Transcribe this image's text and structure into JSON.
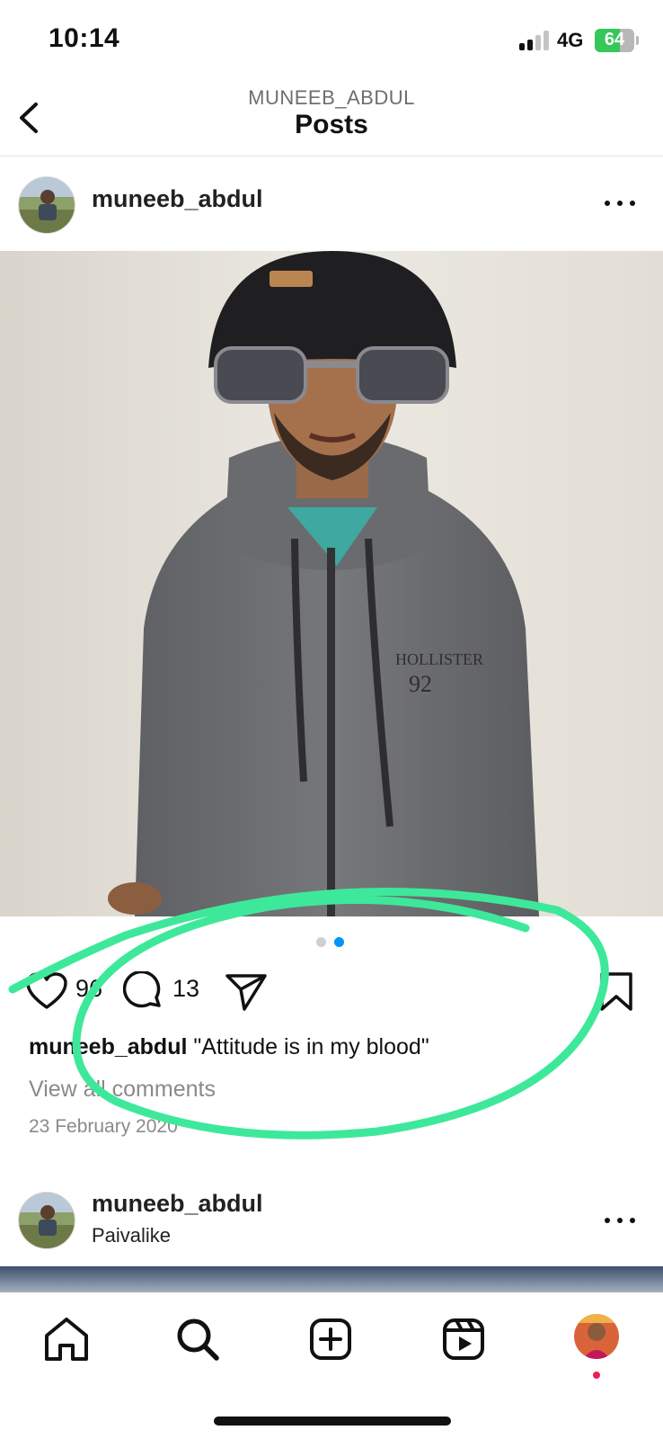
{
  "status_bar": {
    "time": "10:14",
    "network": "4G",
    "battery_level": "64",
    "battery_percent": 64,
    "signal_bars_active": 2,
    "signal_bars_total": 4
  },
  "header": {
    "account_name": "MUNEEB_ABDUL",
    "title": "Posts",
    "back_icon": "chevron-left-icon"
  },
  "post": {
    "username": "muneeb_abdul",
    "more_icon": "more-horizontal-icon",
    "carousel_total": 2,
    "carousel_active": 2,
    "likes_count": "96",
    "comments_count": "13",
    "caption_username": "muneeb_abdul",
    "caption_text": "\"Attitude is in my blood\"",
    "view_comments": "View all comments",
    "date": "23 February 2020"
  },
  "next_post": {
    "username": "muneeb_abdul",
    "location": "Paivalike"
  },
  "tab_bar": {
    "items": [
      "home-icon",
      "search-icon",
      "create-post-icon",
      "reels-icon",
      "profile-avatar"
    ]
  },
  "colors": {
    "accent_blue": "#0095f6",
    "annotation_green": "#3ee89a",
    "notification_red": "#ee1d52",
    "battery_green": "#35c759"
  }
}
